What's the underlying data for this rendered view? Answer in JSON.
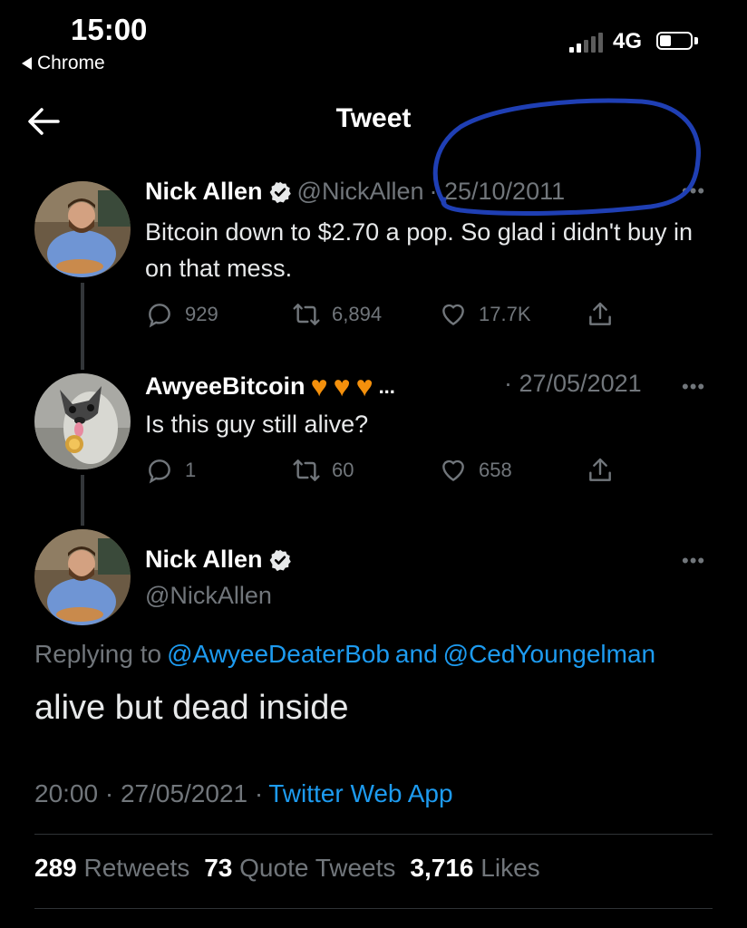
{
  "status_bar": {
    "time": "15:00",
    "back_app": "Chrome",
    "network": "4G"
  },
  "header": {
    "title": "Tweet"
  },
  "tweets": [
    {
      "name": "Nick Allen",
      "handle": "@NickAllen",
      "date": "· 25/10/2011",
      "text": "Bitcoin down to $2.70 a pop. So glad i didn't buy in on that mess.",
      "replies": "929",
      "retweets": "6,894",
      "likes": "17.7K"
    },
    {
      "name": "AwyeeBitcoin",
      "name_suffix": "...",
      "date": "· 27/05/2021",
      "text": "Is this guy still alive?",
      "replies": "1",
      "retweets": "60",
      "likes": "658"
    }
  ],
  "main_tweet": {
    "name": "Nick Allen",
    "handle": "@NickAllen",
    "replying_prefix": "Replying to",
    "replying_user1": "@AwyeeDeaterBob",
    "replying_and": "and",
    "replying_user2": "@CedYoungelman",
    "text": "alive but dead inside",
    "timestamp": "20:00 · 27/05/2021 ·",
    "source": "Twitter Web App",
    "retweets_count": "289",
    "retweets_label": "Retweets",
    "quotes_count": "73",
    "quotes_label": "Quote Tweets",
    "likes_count": "3,716",
    "likes_label": "Likes"
  },
  "icons": {
    "reply": "reply-icon",
    "retweet": "retweet-icon",
    "like": "heart-icon",
    "share": "share-icon",
    "verified": "verified-badge-icon",
    "more": "more-icon"
  },
  "colors": {
    "background": "#000000",
    "link": "#1d9bf0",
    "muted": "#71767b",
    "annotation": "#1f3fb4",
    "heart_emoji": "#f4900c"
  }
}
